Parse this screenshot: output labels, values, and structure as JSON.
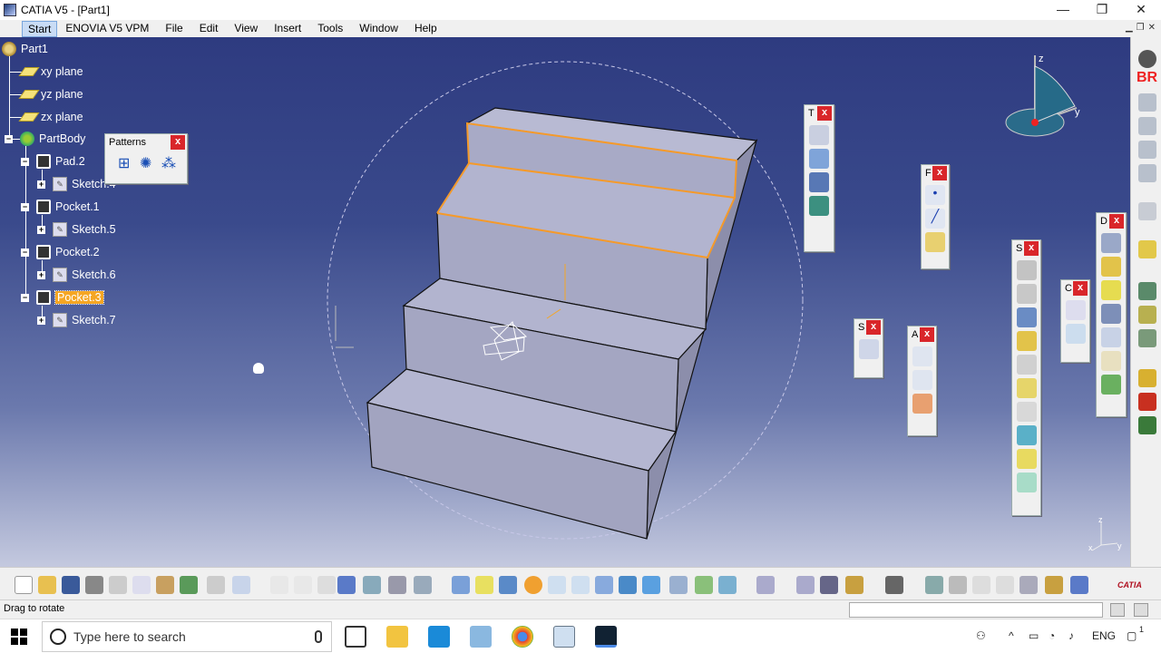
{
  "window": {
    "title": "CATIA V5 - [Part1]",
    "min": "—",
    "max": "❐",
    "close": "✕"
  },
  "menubar": {
    "items": [
      "Start",
      "ENOVIA V5 VPM",
      "File",
      "Edit",
      "View",
      "Insert",
      "Tools",
      "Window",
      "Help"
    ]
  },
  "tree": {
    "part": "Part1",
    "planes": [
      "xy plane",
      "yz plane",
      "zx plane"
    ],
    "body": "PartBody",
    "features": [
      {
        "label": "Pad.2",
        "sketch": "Sketch.4"
      },
      {
        "label": "Pocket.1",
        "sketch": "Sketch.5"
      },
      {
        "label": "Pocket.2",
        "sketch": "Sketch.6"
      },
      {
        "label": "Pocket.3",
        "sketch": "Sketch.7",
        "selected": true
      }
    ]
  },
  "panels": {
    "patterns": {
      "title": "Patterns",
      "close": "x"
    },
    "t": {
      "title": "T",
      "close": "x"
    },
    "f": {
      "title": "F",
      "close": "x"
    },
    "s1": {
      "title": "S",
      "close": "x"
    },
    "a": {
      "title": "A",
      "close": "x"
    },
    "s2": {
      "title": "S",
      "close": "x"
    },
    "c": {
      "title": "C",
      "close": "x"
    },
    "d": {
      "title": "D",
      "close": "x"
    }
  },
  "compass": {
    "z": "z",
    "y": "y"
  },
  "axis": {
    "z": "z",
    "x": "x",
    "y": "y"
  },
  "status": {
    "text": "Drag to rotate"
  },
  "taskbar": {
    "search_placeholder": "Type here to search",
    "lang": "ENG",
    "notif_count": "1"
  },
  "brand": {
    "catia": "CATIA",
    "right_label": "BR"
  },
  "colors": {
    "selection_orange": "#f5a623",
    "close_red": "#d9262a",
    "viewport_top": "#2e3b80"
  }
}
